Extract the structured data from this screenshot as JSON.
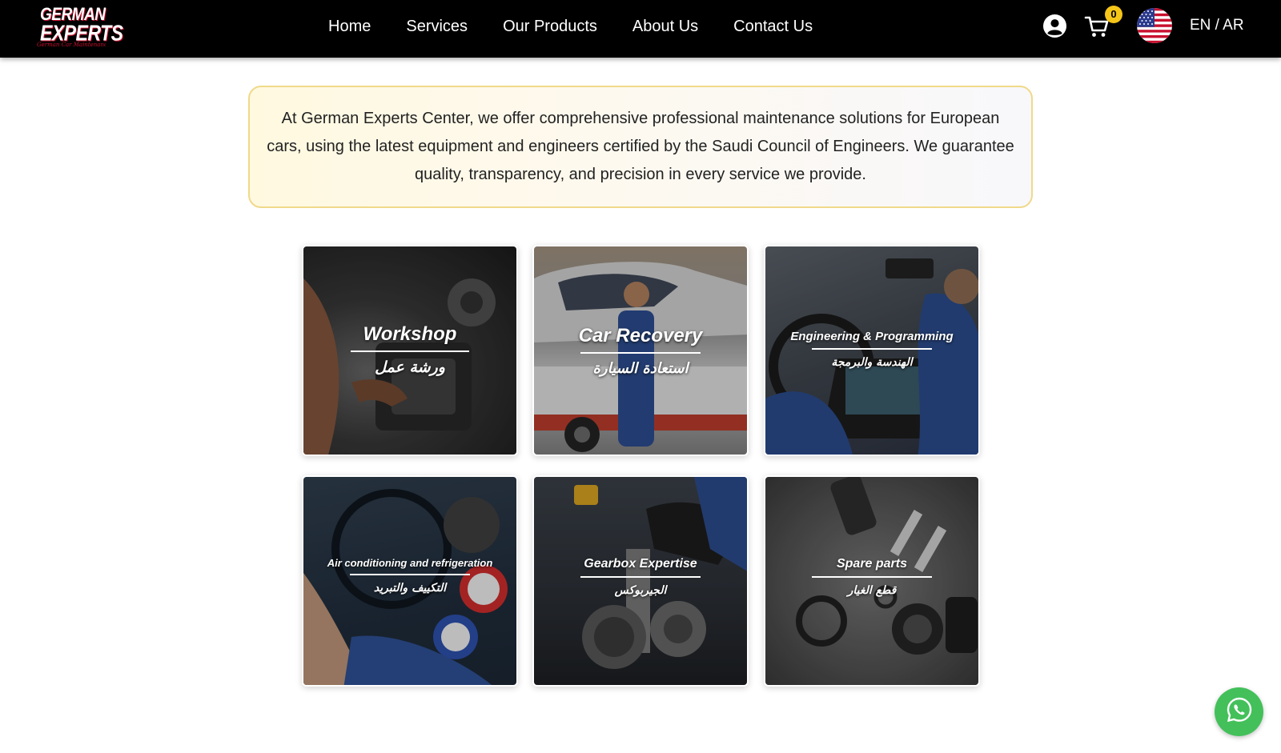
{
  "brand": {
    "logo_line1": "GERMAN",
    "logo_line2": "EXPERTS",
    "logo_sub": "German Car Maintenance"
  },
  "nav": {
    "links": [
      {
        "label": "Home"
      },
      {
        "label": "Services"
      },
      {
        "label": "Our Products"
      },
      {
        "label": "About Us"
      },
      {
        "label": "Contact Us"
      }
    ],
    "cart_count": "0",
    "lang_toggle": "EN / AR",
    "icons": [
      "user-icon",
      "cart-icon",
      "us-flag-icon"
    ]
  },
  "intro": {
    "text": "At German Experts Center, we offer comprehensive professional maintenance solutions for European cars, using the latest equipment and engineers certified by the Saudi Council of Engineers. We guarantee quality, transparency, and precision in every service we provide."
  },
  "services": [
    {
      "title": "Workshop",
      "title_ar": "ورشة عمل"
    },
    {
      "title": "Car Recovery",
      "title_ar": "استعادة السيارة"
    },
    {
      "title": "Engineering & Programming",
      "title_ar": "الهندسة والبرمجة"
    },
    {
      "title": "Air conditioning and refrigeration",
      "title_ar": "التكييف والتبريد"
    },
    {
      "title": "Gearbox Expertise",
      "title_ar": "الجيربوكس"
    },
    {
      "title": "Spare parts",
      "title_ar": "قطع الغيار"
    }
  ],
  "colors": {
    "nav_bg": "#000000",
    "badge": "#f5c518",
    "intro_border": "#f0d98a",
    "whatsapp": "#43c05a"
  }
}
